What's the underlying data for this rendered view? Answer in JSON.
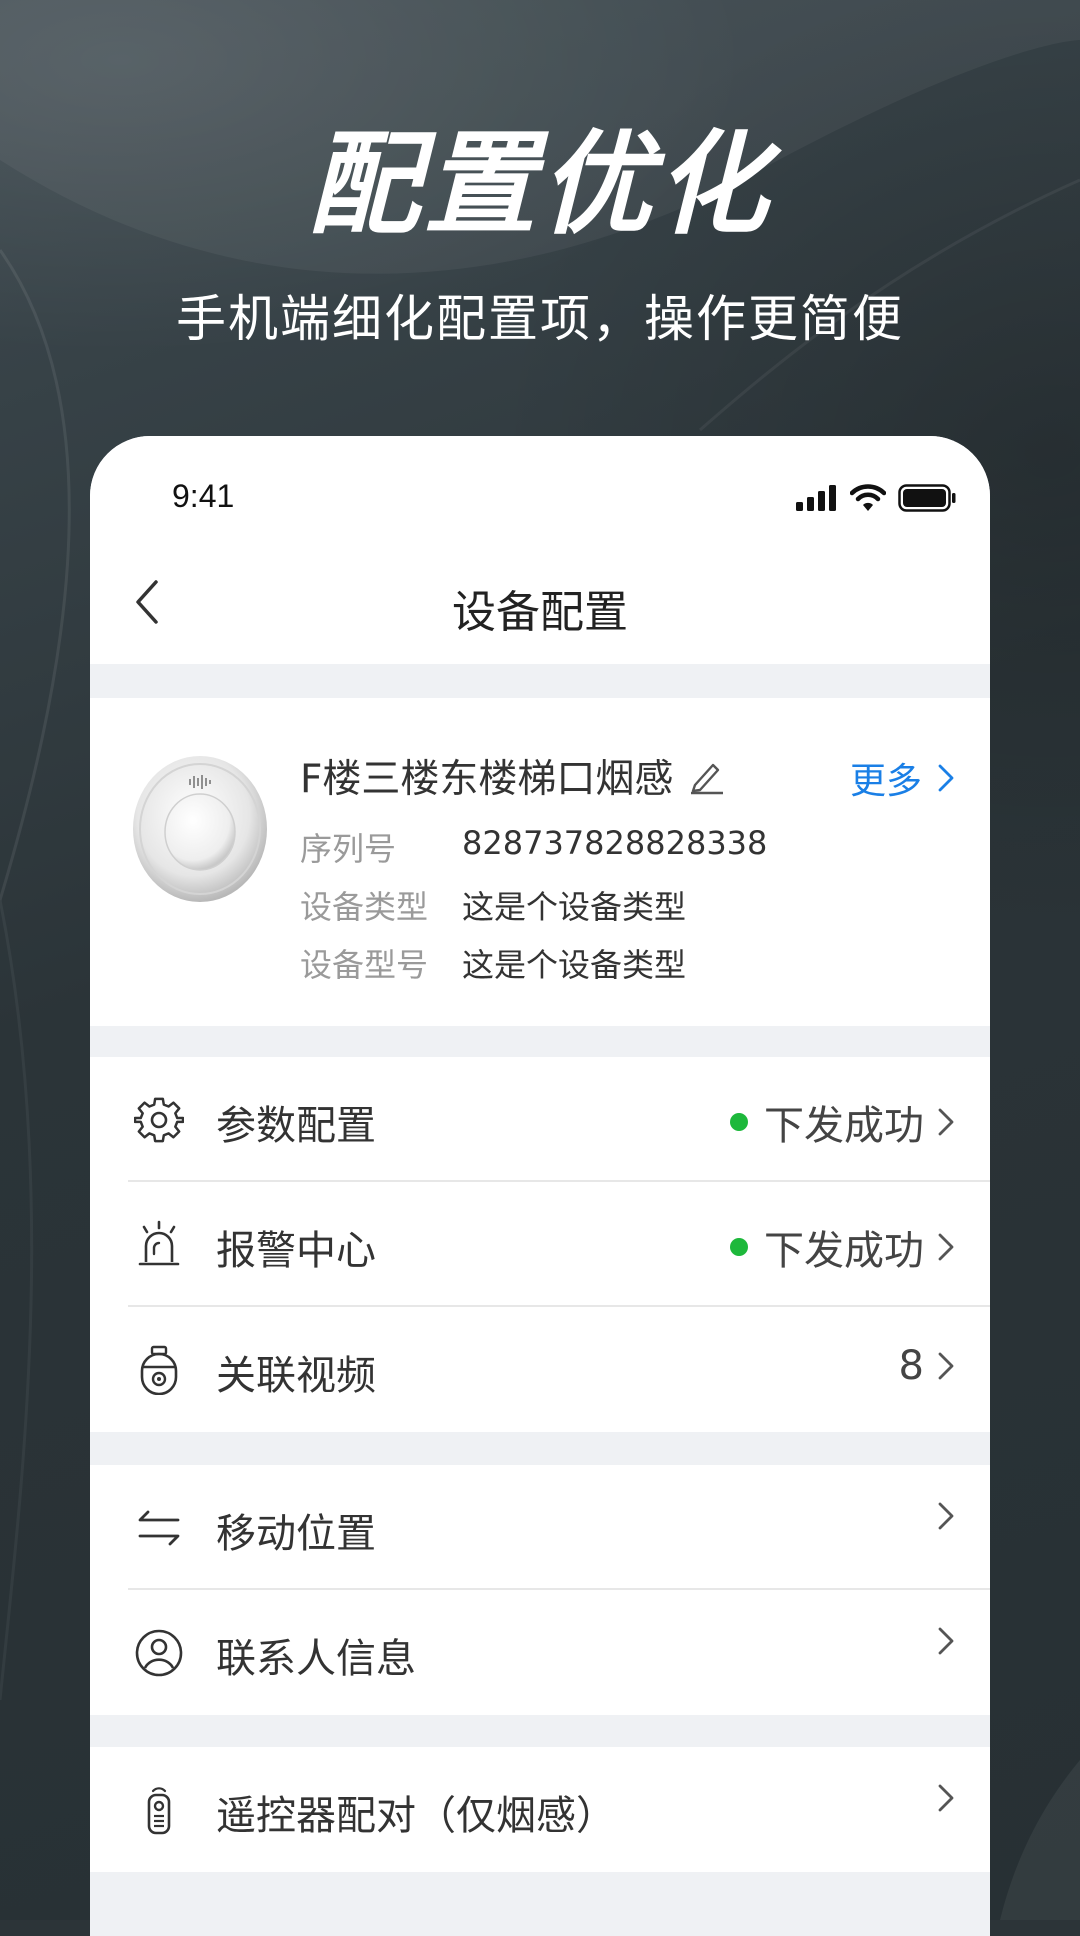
{
  "headline": "配置优化",
  "subline": "手机端细化配置项，操作更简便",
  "status_bar": {
    "time": "9:41"
  },
  "nav": {
    "title": "设备配置"
  },
  "device": {
    "name": "F楼三楼东楼梯口烟感",
    "more": "更多",
    "fields": [
      {
        "key": "序列号",
        "value": "828737828828338"
      },
      {
        "key": "设备类型",
        "value": "这是个设备类型"
      },
      {
        "key": "设备型号",
        "value": "这是个设备类型"
      }
    ]
  },
  "groups": [
    {
      "items": [
        {
          "label": "参数配置",
          "status": "下发成功",
          "icon": "gear-icon"
        },
        {
          "label": "报警中心",
          "status": "下发成功",
          "icon": "alarm-icon"
        },
        {
          "label": "关联视频",
          "value": "8",
          "icon": "camera-icon"
        }
      ]
    },
    {
      "items": [
        {
          "label": "移动位置",
          "icon": "swap-arrows-icon"
        },
        {
          "label": "联系人信息",
          "icon": "contact-icon"
        }
      ]
    },
    {
      "items": [
        {
          "label": "遥控器配对（仅烟感）",
          "icon": "remote-icon"
        }
      ]
    }
  ],
  "colors": {
    "accent": "#1a7fe6",
    "success": "#1db83b",
    "page_bg": "#eff1f4"
  }
}
